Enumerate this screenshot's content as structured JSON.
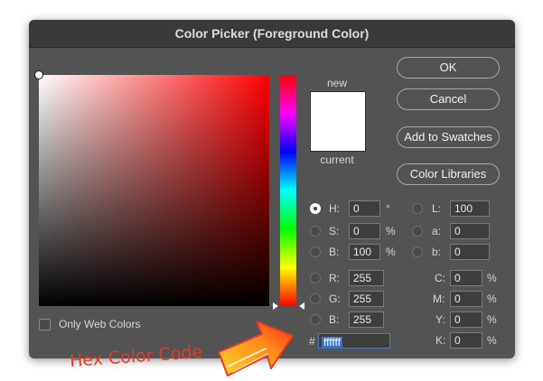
{
  "dialog": {
    "title": "Color Picker (Foreground Color)"
  },
  "buttons": {
    "ok": "OK",
    "cancel": "Cancel",
    "add_to_swatches": "Add to Swatches",
    "color_libraries": "Color Libraries"
  },
  "preview": {
    "new_label": "new",
    "current_label": "current",
    "new_color": "#ffffff",
    "current_color": "#ffffff"
  },
  "hsb": {
    "h": {
      "label": "H:",
      "value": "0",
      "unit": "°",
      "selected": true
    },
    "s": {
      "label": "S:",
      "value": "0",
      "unit": "%",
      "selected": false
    },
    "b": {
      "label": "B:",
      "value": "100",
      "unit": "%",
      "selected": false
    }
  },
  "rgb": {
    "r": {
      "label": "R:",
      "value": "255",
      "selected": false
    },
    "g": {
      "label": "G:",
      "value": "255",
      "selected": false
    },
    "b": {
      "label": "B:",
      "value": "255",
      "selected": false
    }
  },
  "lab": {
    "l": {
      "label": "L:",
      "value": "100",
      "selected": false
    },
    "a": {
      "label": "a:",
      "value": "0",
      "selected": false
    },
    "b": {
      "label": "b:",
      "value": "0",
      "selected": false
    }
  },
  "cmyk": {
    "c": {
      "label": "C:",
      "value": "0",
      "unit": "%"
    },
    "m": {
      "label": "M:",
      "value": "0",
      "unit": "%"
    },
    "y": {
      "label": "Y:",
      "value": "0",
      "unit": "%"
    },
    "k": {
      "label": "K:",
      "value": "0",
      "unit": "%"
    }
  },
  "hex": {
    "symbol": "#",
    "value": "ffffff"
  },
  "web_colors": {
    "label": "Only Web Colors",
    "checked": false
  },
  "annotation": {
    "text": "Hex Color Code",
    "color": "#e23b2b",
    "arrow_colors": [
      "#ff2a10",
      "#ffd42a"
    ]
  },
  "colors": {
    "dialog_bg": "#535353",
    "titlebar_bg": "#3a3a3a",
    "hex_highlight": "#3b74c9"
  },
  "icons": [
    "field-marker",
    "hue-arrow-icon",
    "radio-icon",
    "checkbox-icon",
    "annotation-arrow-icon"
  ]
}
